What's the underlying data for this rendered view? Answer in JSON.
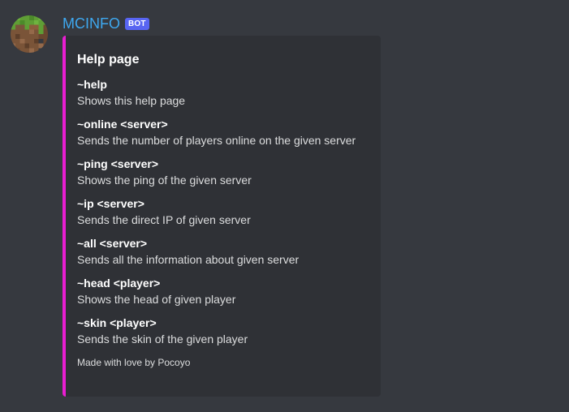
{
  "author": {
    "name": "MCINFO",
    "tag": "BOT",
    "avatar_icon": "minecraft-grass-block-icon"
  },
  "embed": {
    "accent_color": "#e91ed1",
    "title": "Help page",
    "fields": [
      {
        "name": "~help",
        "value": "Shows this help page"
      },
      {
        "name": "~online <server>",
        "value": "Sends the number of players online on the given server"
      },
      {
        "name": "~ping <server>",
        "value": "Shows the ping of the given server"
      },
      {
        "name": "~ip <server>",
        "value": "Sends the direct IP of given server"
      },
      {
        "name": "~all <server>",
        "value": "Sends all the information about given server"
      },
      {
        "name": "~head <player>",
        "value": "Shows the head of given player"
      },
      {
        "name": "~skin <player>",
        "value": "Sends the skin of the given player"
      }
    ],
    "footer": "Made with love by Pocoyo"
  }
}
